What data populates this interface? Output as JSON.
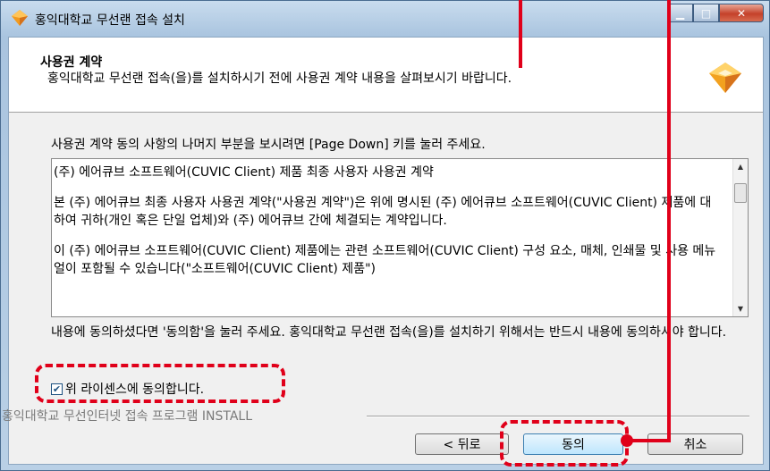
{
  "window": {
    "title": "홍익대학교 무선랜 접속 설치"
  },
  "header": {
    "title": "사용권 계약",
    "subtitle": "홍익대학교 무선랜 접속(을)를 설치하시기 전에 사용권 계약 내용을 살펴보시기 바랍니다."
  },
  "instruction": "사용권 계약 동의 사항의 나머지 부분을 보시려면 [Page Down] 키를 눌러 주세요.",
  "license": {
    "paragraphs": [
      "(주) 에어큐브 소프트웨어(CUVIC Client) 제품 최종 사용자 사용권 계약",
      "본 (주) 에어큐브 최종 사용자 사용권 계약(\"사용권 계약\")은 위에 명시된 (주) 에어큐브 소프트웨어(CUVIC Client) 제품에 대하여 귀하(개인 혹은 단일 업체)와 (주) 에어큐브 간에 체결되는 계약입니다.",
      "이 (주) 에어큐브 소프트웨어(CUVIC Client) 제품에는 관련 소프트웨어(CUVIC Client) 구성 요소, 매체, 인쇄물 및 사용 메뉴얼이 포함될 수 있습니다(\"소프트웨어(CUVIC Client) 제품\")"
    ]
  },
  "agree_text": "내용에 동의하셨다면 '동의함'을 눌러 주세요. 홍익대학교 무선랜 접속(을)를 설치하기 위해서는 반드시 내용에 동의하셔야 합니다.",
  "checkbox": {
    "label": "위 라이센스에 동의합니다.",
    "checked": true
  },
  "footer": {
    "group_label": "홍익대학교 무선인터넷 접속 프로그램 INSTALL"
  },
  "buttons": {
    "back": "< 뒤로",
    "agree": "동의",
    "cancel": "취소"
  },
  "colors": {
    "highlight": "#e0001a"
  }
}
